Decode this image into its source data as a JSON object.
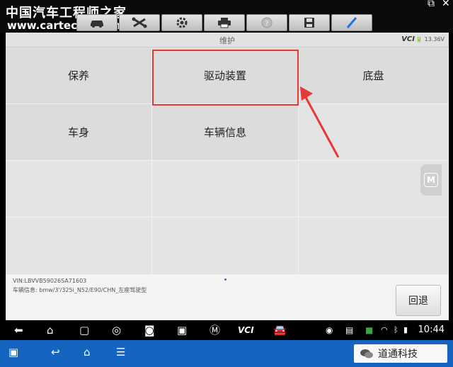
{
  "watermark": {
    "title": "中国汽车工程师之家",
    "url": "www.cartech8.com"
  },
  "toolbar": {
    "buttons": [
      {
        "name": "car-icon"
      },
      {
        "name": "wrench-icon"
      },
      {
        "name": "gear-icon"
      },
      {
        "name": "printer-icon"
      },
      {
        "name": "help-icon"
      },
      {
        "name": "save-icon"
      },
      {
        "name": "pen-icon"
      }
    ]
  },
  "screen": {
    "title": "维护",
    "vci_label": "VCI",
    "battery": "13.36V"
  },
  "menu": {
    "items": [
      "保养",
      "驱动装置",
      "底盘",
      "车身",
      "车辆信息"
    ],
    "highlighted": "驱动装置"
  },
  "info": {
    "vin": "VIN:LBVVB59026SA71603",
    "vehicle": "车辆信息: bmw/3'/325i_N52/E90/CHN_左座驾驶型",
    "back_label": "回退"
  },
  "statusbar": {
    "time": "10:44",
    "vci_label": "VCI"
  },
  "wechat": {
    "name": "道通科技"
  },
  "colors": {
    "highlight": "#e53935",
    "accent_blue": "#1565c0",
    "vci_green": "#3aa640"
  }
}
